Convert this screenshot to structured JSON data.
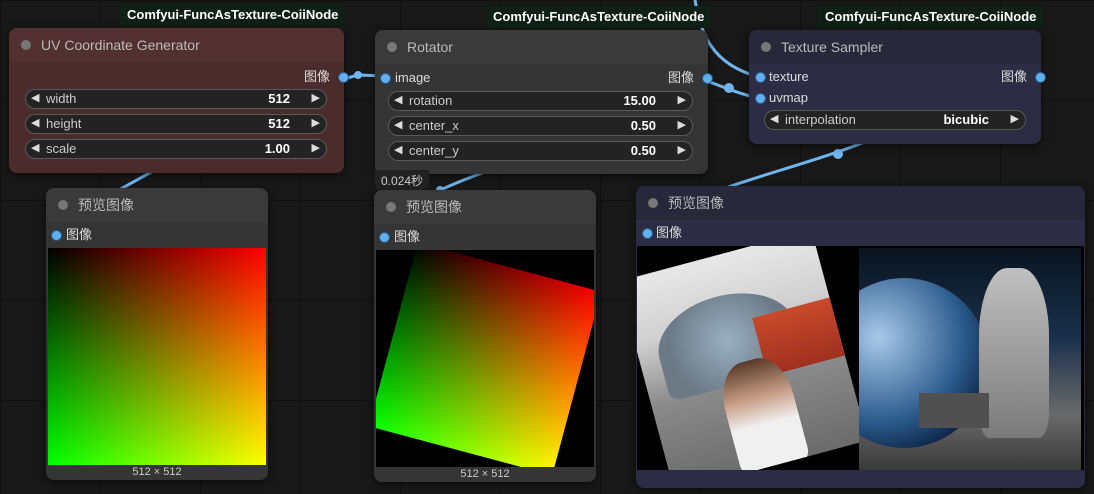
{
  "badges": {
    "uv": "Comfyui-FuncAsTexture-CoiiNode",
    "rotator": "Comfyui-FuncAsTexture-CoiiNode",
    "sampler": "Comfyui-FuncAsTexture-CoiiNode"
  },
  "uv_node": {
    "title": "UV Coordinate Generator",
    "output_label": "图像",
    "width_label": "width",
    "width_value": "512",
    "height_label": "height",
    "height_value": "512",
    "scale_label": "scale",
    "scale_value": "1.00"
  },
  "rotator_node": {
    "title": "Rotator",
    "input_label": "image",
    "output_label": "图像",
    "rotation_label": "rotation",
    "rotation_value": "15.00",
    "center_x_label": "center_x",
    "center_x_value": "0.50",
    "center_y_label": "center_y",
    "center_y_value": "0.50",
    "timing": "0.024秒"
  },
  "sampler_node": {
    "title": "Texture Sampler",
    "input_texture": "texture",
    "input_uvmap": "uvmap",
    "output_label": "图像",
    "interp_label": "interpolation",
    "interp_value": "bicubic"
  },
  "preview1": {
    "title": "预览图像",
    "input_label": "图像",
    "size": "512 × 512"
  },
  "preview2": {
    "title": "预览图像",
    "input_label": "图像",
    "size": "512 × 512"
  },
  "preview3": {
    "title": "预览图像",
    "input_label": "图像"
  },
  "arrows": {
    "left": "◀",
    "right": "▶"
  },
  "colors": {
    "wire": "#6fb6ee",
    "uv_node_bg": "#4a2c2c",
    "uv_node_title": "#533030",
    "default_node_bg": "#353535",
    "sampler_node_bg": "#2c2c44",
    "socket": "#60b0f0"
  },
  "icons": {
    "arrow_left": "triangle-left-icon",
    "arrow_right": "triangle-right-icon",
    "socket": "socket-dot-icon"
  }
}
